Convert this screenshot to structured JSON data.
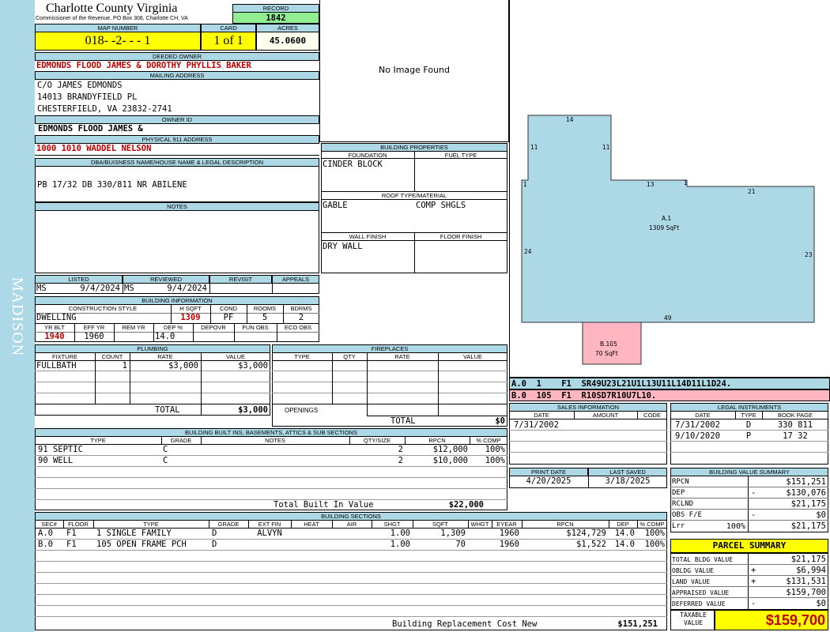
{
  "side_label": "MADISON",
  "header": {
    "county": "Charlotte County Virginia",
    "subtitle": "Commissioner of the Revenue, PO Box 308, Charlotte CH, VA"
  },
  "record": {
    "label": "RECORD",
    "value": "1842"
  },
  "map_number": {
    "label": "MAP NUMBER",
    "value": "018- -2- - - 1"
  },
  "card": {
    "label": "CARD",
    "value": "1 of 1"
  },
  "acres": {
    "label": "ACRES",
    "value": "45.0600"
  },
  "deeded_owner": {
    "label": "DEEDED OWNER",
    "value": "EDMONDS FLOOD JAMES & DOROTHY PHYLLIS BAKER"
  },
  "mailing": {
    "label": "MAILING ADDRESS",
    "lines": [
      "C/O JAMES EDMONDS",
      "14013 BRANDYFIELD PL",
      "CHESTERFIELD, VA 23832-2741"
    ]
  },
  "owner_id": {
    "label": "OWNER ID",
    "value": "EDMONDS FLOOD JAMES &"
  },
  "physical": {
    "label": "PHYSICAL 911 ADDRESS",
    "value": "1000 1010 WADDEL NELSON"
  },
  "legal": {
    "label": "DBA/BUISNESS NAME/HOUSE NAME & LEGAL DESCRIPTION",
    "value": "PB 17/32 DB 330/811 NR ABILENE"
  },
  "notes": {
    "label": "NOTES"
  },
  "listed": {
    "labels": [
      "LISTED",
      "REVIEWED",
      "REVISIT",
      "APPEALS"
    ],
    "listed_by": "MS",
    "listed_date": "9/4/2024",
    "reviewed_by": "MS",
    "reviewed_date": "9/4/2024"
  },
  "building_info": {
    "label": "BUILDING INFORMATION",
    "h1": [
      "CONSTRUCTION STYLE",
      "H SQFT",
      "COND",
      "ROOMS",
      "BDRMS"
    ],
    "v1": [
      "DWELLING",
      "1309",
      "PF",
      "5",
      "2"
    ],
    "h2": [
      "YR BLT",
      "EFF YR",
      "REM YR",
      "DEP %",
      "DEPOVR",
      "FUN OBS",
      "ECO OBS"
    ],
    "v2": [
      "1940",
      "1960",
      "",
      "14.0",
      "",
      "",
      ""
    ]
  },
  "plumbing": {
    "label": "PLUMBING",
    "cols": [
      "FIXTURE",
      "COUNT",
      "RATE",
      "VALUE"
    ],
    "rows": [
      [
        "FULLBATH",
        "1",
        "$3,000",
        "$3,000"
      ]
    ],
    "total_label": "TOTAL",
    "total": "$3,000"
  },
  "fireplaces": {
    "label": "FIREPLACES",
    "cols": [
      "TYPE",
      "QTY",
      "RATE",
      "VALUE"
    ],
    "openings": "OPENINGS",
    "total_label": "TOTAL",
    "total": "$0"
  },
  "image": {
    "text": "No Image Found"
  },
  "bprops": {
    "label": "BUILDING PROPERTIES",
    "foundation_label": "FOUNDATION",
    "foundation": "CINDER BLOCK",
    "fuel_label": "FUEL TYPE",
    "roof_label": "ROOF TYPE/MATERIAL",
    "roof_type": "GABLE",
    "roof_material": "COMP SHGLS",
    "wall_label": "WALL FINISH",
    "wall": "DRY WALL",
    "floor_label": "FLOOR FINISH"
  },
  "sketch": {
    "dims": {
      "top": "14",
      "left_upper": "11",
      "right_upper": "11",
      "left_step": "1",
      "mid": "13",
      "mid_step": "1",
      "right_top": "21",
      "left": "24",
      "right": "23",
      "bottom": "49"
    },
    "a_label": "A.1",
    "a_area": "1309 SqFt",
    "b_label": "B.105",
    "b_area": "70 SqFt",
    "code_a": "A.0  1    F1  SR49U23L21U1L13U11L14D11L1D24.",
    "code_b": "B.0  105  F1  R10SD7R10U7L10.",
    "main_color": "#add8e6",
    "porch_color": "#ffb6c1"
  },
  "sales": {
    "label": "SALES INFORMATION",
    "cols": [
      "DATE",
      "AMOUNT",
      "CODE"
    ],
    "rows": [
      [
        "7/31/2002",
        "",
        ""
      ]
    ]
  },
  "legal_inst": {
    "label": "LEGAL INSTRUMENTS",
    "cols": [
      "DATE",
      "TYPE",
      "BOOK PAGE"
    ],
    "rows": [
      [
        "7/31/2002",
        "D",
        "330 811"
      ],
      [
        "9/10/2020",
        "P",
        "17 32"
      ]
    ]
  },
  "print": {
    "labels": [
      "PRINT DATE",
      "LAST SAVED"
    ],
    "values": [
      "4/20/2025",
      "3/18/2025"
    ]
  },
  "bvs": {
    "label": "BUILDING VALUE SUMMARY",
    "rows": [
      {
        "name": "RPCN",
        "pct": "",
        "sign": "",
        "value": "$151,251"
      },
      {
        "name": "DEP",
        "pct": "",
        "sign": "-",
        "value": "$130,076"
      },
      {
        "name": "RCLND",
        "pct": "",
        "sign": "",
        "value": "$21,175"
      },
      {
        "name": "OBS F/E",
        "pct": "",
        "sign": "-",
        "value": "$0"
      },
      {
        "name": "Lrr",
        "pct": "100%",
        "sign": "",
        "value": "$21,175"
      }
    ]
  },
  "parcel": {
    "label": "PARCEL SUMMARY",
    "rows": [
      {
        "name": "TOTAL BLDG VALUE",
        "sign": "",
        "value": "$21,175"
      },
      {
        "name": "OBLDG VALUE",
        "sign": "+",
        "value": "$6,994"
      },
      {
        "name": "LAND VALUE",
        "sign": "+",
        "value": "$131,531"
      },
      {
        "name": "APPRAISED VALUE",
        "sign": "",
        "value": "$159,700"
      },
      {
        "name": "DEFERRED VALUE",
        "sign": "-",
        "value": "$0"
      }
    ],
    "taxable_label": "TAXABLE VALUE",
    "taxable": "$159,700"
  },
  "builtins": {
    "label": "BUILDING BUILT INS, BASEMENTS, ATTICS & SUB SECTIONS",
    "cols": [
      "TYPE",
      "GRADE",
      "NOTES",
      "QTY/SIZE",
      "RPCN",
      "% COMP"
    ],
    "rows": [
      [
        "91 SEPTIC",
        "C",
        "",
        "2",
        "$12,000",
        "100%"
      ],
      [
        "90 WELL",
        "C",
        "",
        "2",
        "$10,000",
        "100%"
      ]
    ],
    "total_label": "Total Built In Value",
    "total": "$22,000"
  },
  "sections": {
    "label": "BUILDING SECTIONS",
    "cols": [
      "SEC#",
      "FLOOR",
      "TYPE",
      "GRADE",
      "EXT FIN",
      "HEAT",
      "AIR",
      "SHGT",
      "SQFT",
      "WHGT",
      "EYEAR",
      "RPCN",
      "DEP",
      "% COMP"
    ],
    "rows": [
      [
        "A.0",
        "F1",
        "1 SINGLE FAMILY",
        "D",
        "ALVYN",
        "",
        "",
        "1.00",
        "1,309",
        "",
        "1960",
        "$124,729",
        "14.0",
        "100%"
      ],
      [
        "B.0",
        "F1",
        "105 OPEN FRAME PCH",
        "D",
        "",
        "",
        "",
        "1.00",
        "70",
        "",
        "1960",
        "$1,522",
        "14.0",
        "100%"
      ]
    ],
    "total_label": "Building Replacement Cost New",
    "total": "$151,251"
  }
}
